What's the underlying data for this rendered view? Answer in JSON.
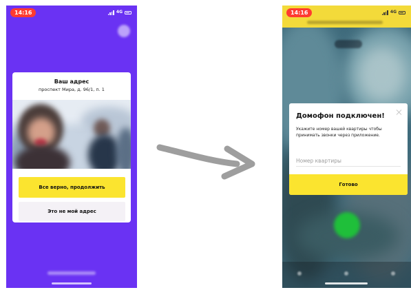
{
  "status_bar": {
    "time": "14:16",
    "network": "4G"
  },
  "address_screen": {
    "title": "Ваш адрес",
    "address": "проспект Мира, д. 96/1, п. 1",
    "confirm_label": "Все верно, продолжить",
    "not_my_address_label": "Это не мой адрес"
  },
  "intercom_screen": {
    "modal_title": "Домофон подключен!",
    "modal_text": "Укажите номер вашей квартиры чтобы принимать звонки через приложение.",
    "apartment_placeholder": "Номер квартиры",
    "done_label": "Готово"
  },
  "colors": {
    "left_background": "#6a32f3",
    "accent_yellow": "#fbe42f",
    "secondary_button": "#f4f1f6",
    "arrow": "#9e9e9e",
    "call_green": "#1fbf3a"
  },
  "icons": {
    "close": "close-icon",
    "arrow": "arrow-right-icon",
    "signal": "signal-icon",
    "battery": "battery-icon"
  }
}
